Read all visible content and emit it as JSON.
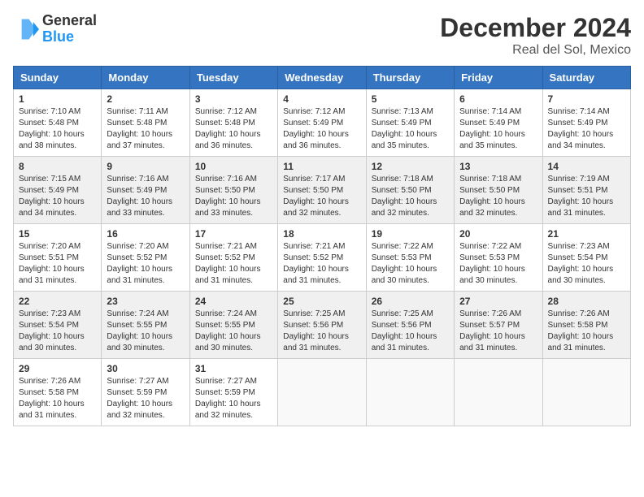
{
  "header": {
    "logo_line1": "General",
    "logo_line2": "Blue",
    "title": "December 2024",
    "subtitle": "Real del Sol, Mexico"
  },
  "weekdays": [
    "Sunday",
    "Monday",
    "Tuesday",
    "Wednesday",
    "Thursday",
    "Friday",
    "Saturday"
  ],
  "weeks": [
    [
      {
        "day": "1",
        "sunrise": "7:10 AM",
        "sunset": "5:48 PM",
        "daylight": "10 hours and 38 minutes."
      },
      {
        "day": "2",
        "sunrise": "7:11 AM",
        "sunset": "5:48 PM",
        "daylight": "10 hours and 37 minutes."
      },
      {
        "day": "3",
        "sunrise": "7:12 AM",
        "sunset": "5:48 PM",
        "daylight": "10 hours and 36 minutes."
      },
      {
        "day": "4",
        "sunrise": "7:12 AM",
        "sunset": "5:49 PM",
        "daylight": "10 hours and 36 minutes."
      },
      {
        "day": "5",
        "sunrise": "7:13 AM",
        "sunset": "5:49 PM",
        "daylight": "10 hours and 35 minutes."
      },
      {
        "day": "6",
        "sunrise": "7:14 AM",
        "sunset": "5:49 PM",
        "daylight": "10 hours and 35 minutes."
      },
      {
        "day": "7",
        "sunrise": "7:14 AM",
        "sunset": "5:49 PM",
        "daylight": "10 hours and 34 minutes."
      }
    ],
    [
      {
        "day": "8",
        "sunrise": "7:15 AM",
        "sunset": "5:49 PM",
        "daylight": "10 hours and 34 minutes."
      },
      {
        "day": "9",
        "sunrise": "7:16 AM",
        "sunset": "5:49 PM",
        "daylight": "10 hours and 33 minutes."
      },
      {
        "day": "10",
        "sunrise": "7:16 AM",
        "sunset": "5:50 PM",
        "daylight": "10 hours and 33 minutes."
      },
      {
        "day": "11",
        "sunrise": "7:17 AM",
        "sunset": "5:50 PM",
        "daylight": "10 hours and 32 minutes."
      },
      {
        "day": "12",
        "sunrise": "7:18 AM",
        "sunset": "5:50 PM",
        "daylight": "10 hours and 32 minutes."
      },
      {
        "day": "13",
        "sunrise": "7:18 AM",
        "sunset": "5:50 PM",
        "daylight": "10 hours and 32 minutes."
      },
      {
        "day": "14",
        "sunrise": "7:19 AM",
        "sunset": "5:51 PM",
        "daylight": "10 hours and 31 minutes."
      }
    ],
    [
      {
        "day": "15",
        "sunrise": "7:20 AM",
        "sunset": "5:51 PM",
        "daylight": "10 hours and 31 minutes."
      },
      {
        "day": "16",
        "sunrise": "7:20 AM",
        "sunset": "5:52 PM",
        "daylight": "10 hours and 31 minutes."
      },
      {
        "day": "17",
        "sunrise": "7:21 AM",
        "sunset": "5:52 PM",
        "daylight": "10 hours and 31 minutes."
      },
      {
        "day": "18",
        "sunrise": "7:21 AM",
        "sunset": "5:52 PM",
        "daylight": "10 hours and 31 minutes."
      },
      {
        "day": "19",
        "sunrise": "7:22 AM",
        "sunset": "5:53 PM",
        "daylight": "10 hours and 30 minutes."
      },
      {
        "day": "20",
        "sunrise": "7:22 AM",
        "sunset": "5:53 PM",
        "daylight": "10 hours and 30 minutes."
      },
      {
        "day": "21",
        "sunrise": "7:23 AM",
        "sunset": "5:54 PM",
        "daylight": "10 hours and 30 minutes."
      }
    ],
    [
      {
        "day": "22",
        "sunrise": "7:23 AM",
        "sunset": "5:54 PM",
        "daylight": "10 hours and 30 minutes."
      },
      {
        "day": "23",
        "sunrise": "7:24 AM",
        "sunset": "5:55 PM",
        "daylight": "10 hours and 30 minutes."
      },
      {
        "day": "24",
        "sunrise": "7:24 AM",
        "sunset": "5:55 PM",
        "daylight": "10 hours and 30 minutes."
      },
      {
        "day": "25",
        "sunrise": "7:25 AM",
        "sunset": "5:56 PM",
        "daylight": "10 hours and 31 minutes."
      },
      {
        "day": "26",
        "sunrise": "7:25 AM",
        "sunset": "5:56 PM",
        "daylight": "10 hours and 31 minutes."
      },
      {
        "day": "27",
        "sunrise": "7:26 AM",
        "sunset": "5:57 PM",
        "daylight": "10 hours and 31 minutes."
      },
      {
        "day": "28",
        "sunrise": "7:26 AM",
        "sunset": "5:58 PM",
        "daylight": "10 hours and 31 minutes."
      }
    ],
    [
      {
        "day": "29",
        "sunrise": "7:26 AM",
        "sunset": "5:58 PM",
        "daylight": "10 hours and 31 minutes."
      },
      {
        "day": "30",
        "sunrise": "7:27 AM",
        "sunset": "5:59 PM",
        "daylight": "10 hours and 32 minutes."
      },
      {
        "day": "31",
        "sunrise": "7:27 AM",
        "sunset": "5:59 PM",
        "daylight": "10 hours and 32 minutes."
      },
      null,
      null,
      null,
      null
    ]
  ]
}
